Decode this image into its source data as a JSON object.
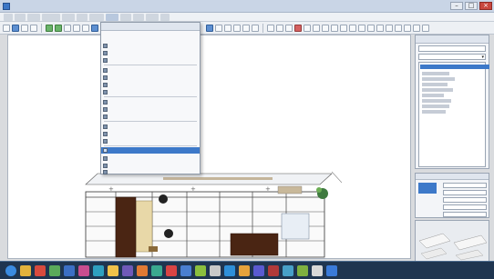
{
  "window": {
    "title": "",
    "controls": [
      "minimize",
      "maximize",
      "close"
    ]
  },
  "menubar": {
    "items": [
      "",
      "",
      "",
      "",
      "",
      "",
      "",
      "",
      "",
      "",
      "",
      ""
    ]
  },
  "toolbar": {
    "left_icons": [
      "new-icon",
      "open-icon",
      "save-icon",
      "print-icon",
      "undo-icon",
      "redo-icon",
      "cut-icon",
      "copy-icon",
      "paste-icon",
      "zoom-icon"
    ],
    "right_icons": [
      "select-icon",
      "wall-icon",
      "door-icon",
      "window-icon",
      "stairs-icon",
      "room-icon",
      "dimension-icon",
      "text-icon",
      "camera-icon",
      "render-icon",
      "library-icon",
      "layer-icon"
    ]
  },
  "dropdown_menu": {
    "title": "",
    "items": [
      {
        "label": "",
        "shortcut": ""
      },
      {
        "label": "",
        "shortcut": ""
      },
      {
        "label": "",
        "shortcut": ""
      },
      {
        "label": "",
        "shortcut": ""
      },
      {
        "label": "",
        "shortcut": ""
      },
      {
        "label": "",
        "shortcut": ""
      },
      {
        "label": "",
        "shortcut": ""
      },
      {
        "label": "",
        "shortcut": ""
      },
      {
        "label": "",
        "shortcut": ""
      },
      {
        "label": "",
        "shortcut": ""
      },
      {
        "label": "",
        "shortcut": ""
      },
      {
        "label": "",
        "shortcut": ""
      },
      {
        "label": "",
        "shortcut": ""
      },
      {
        "label": "",
        "shortcut": ""
      },
      {
        "label": "",
        "shortcut": ""
      },
      {
        "label": "",
        "shortcut": ""
      },
      {
        "label": "",
        "shortcut": ""
      }
    ],
    "selected_index": 12
  },
  "right_panel": {
    "title": "",
    "search_value": "",
    "category": "",
    "items": [
      "",
      "",
      "",
      "",
      "",
      "",
      "",
      "",
      ""
    ]
  },
  "properties_panel": {
    "rows": [
      "",
      "",
      "",
      "",
      ""
    ]
  },
  "taskbar": {
    "apps": [
      "start-icon",
      "explorer-icon",
      "browser-icon",
      "media-icon",
      "mail-icon",
      "app-icon",
      "app-icon",
      "app-icon",
      "app-icon",
      "app-icon",
      "app-icon",
      "app-icon",
      "app-icon",
      "app-icon",
      "app-icon",
      "app-icon",
      "app-icon",
      "app-icon",
      "app-icon",
      "app-icon",
      "app-icon",
      "app-icon",
      "app-icon"
    ]
  },
  "colors": {
    "accent": "#3d79c9",
    "canvas": "#ffffff",
    "taskbar": "#1f3550",
    "furniture_dark": "#4a2513",
    "furniture_light": "#e8d8a8"
  }
}
